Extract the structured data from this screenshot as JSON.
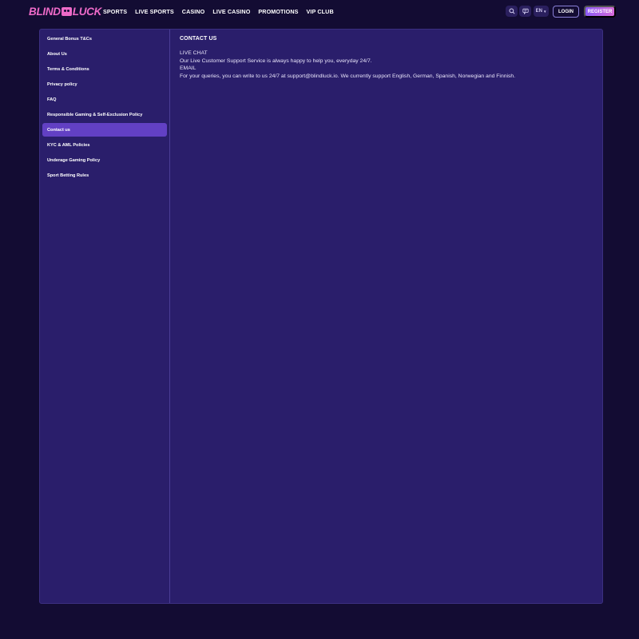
{
  "header": {
    "logo_left": "BLIND",
    "logo_right": "LUCK",
    "nav": [
      "SPORTS",
      "LIVE SPORTS",
      "CASINO",
      "LIVE CASINO",
      "PROMOTIONS",
      "VIP CLUB"
    ],
    "icons": {
      "search": "search-icon",
      "chat": "chat-icon"
    },
    "lang": "EN",
    "login_label": "LOGIN",
    "register_label": "REGISTER"
  },
  "sidebar": {
    "items": [
      {
        "label": "General Bonus T&Cs"
      },
      {
        "label": "About Us"
      },
      {
        "label": "Terms & Conditions"
      },
      {
        "label": "Privacy policy"
      },
      {
        "label": "FAQ"
      },
      {
        "label": "Responsible Gaming & Self-Exclusion Policy"
      },
      {
        "label": "Contact us"
      },
      {
        "label": "KYC & AML Policies"
      },
      {
        "label": "Underage Gaming Policy"
      },
      {
        "label": "Sport Betting Rules"
      }
    ],
    "active_index": 6
  },
  "content": {
    "title": "CONTACT US",
    "lines": [
      "LIVE CHAT",
      "Our Live Customer Support Service is always happy to help you, everyday 24/7.",
      "EMAIL",
      "For your queries, you can write to us 24/7 at support@blindluck.io. We currently support English, German, Spanish, Norwegian and Finnish."
    ]
  },
  "colors": {
    "background": "#130c33",
    "panel": "#2a1e6b",
    "active_item": "#6240c4",
    "accent_pink": "#ee6ac8"
  }
}
